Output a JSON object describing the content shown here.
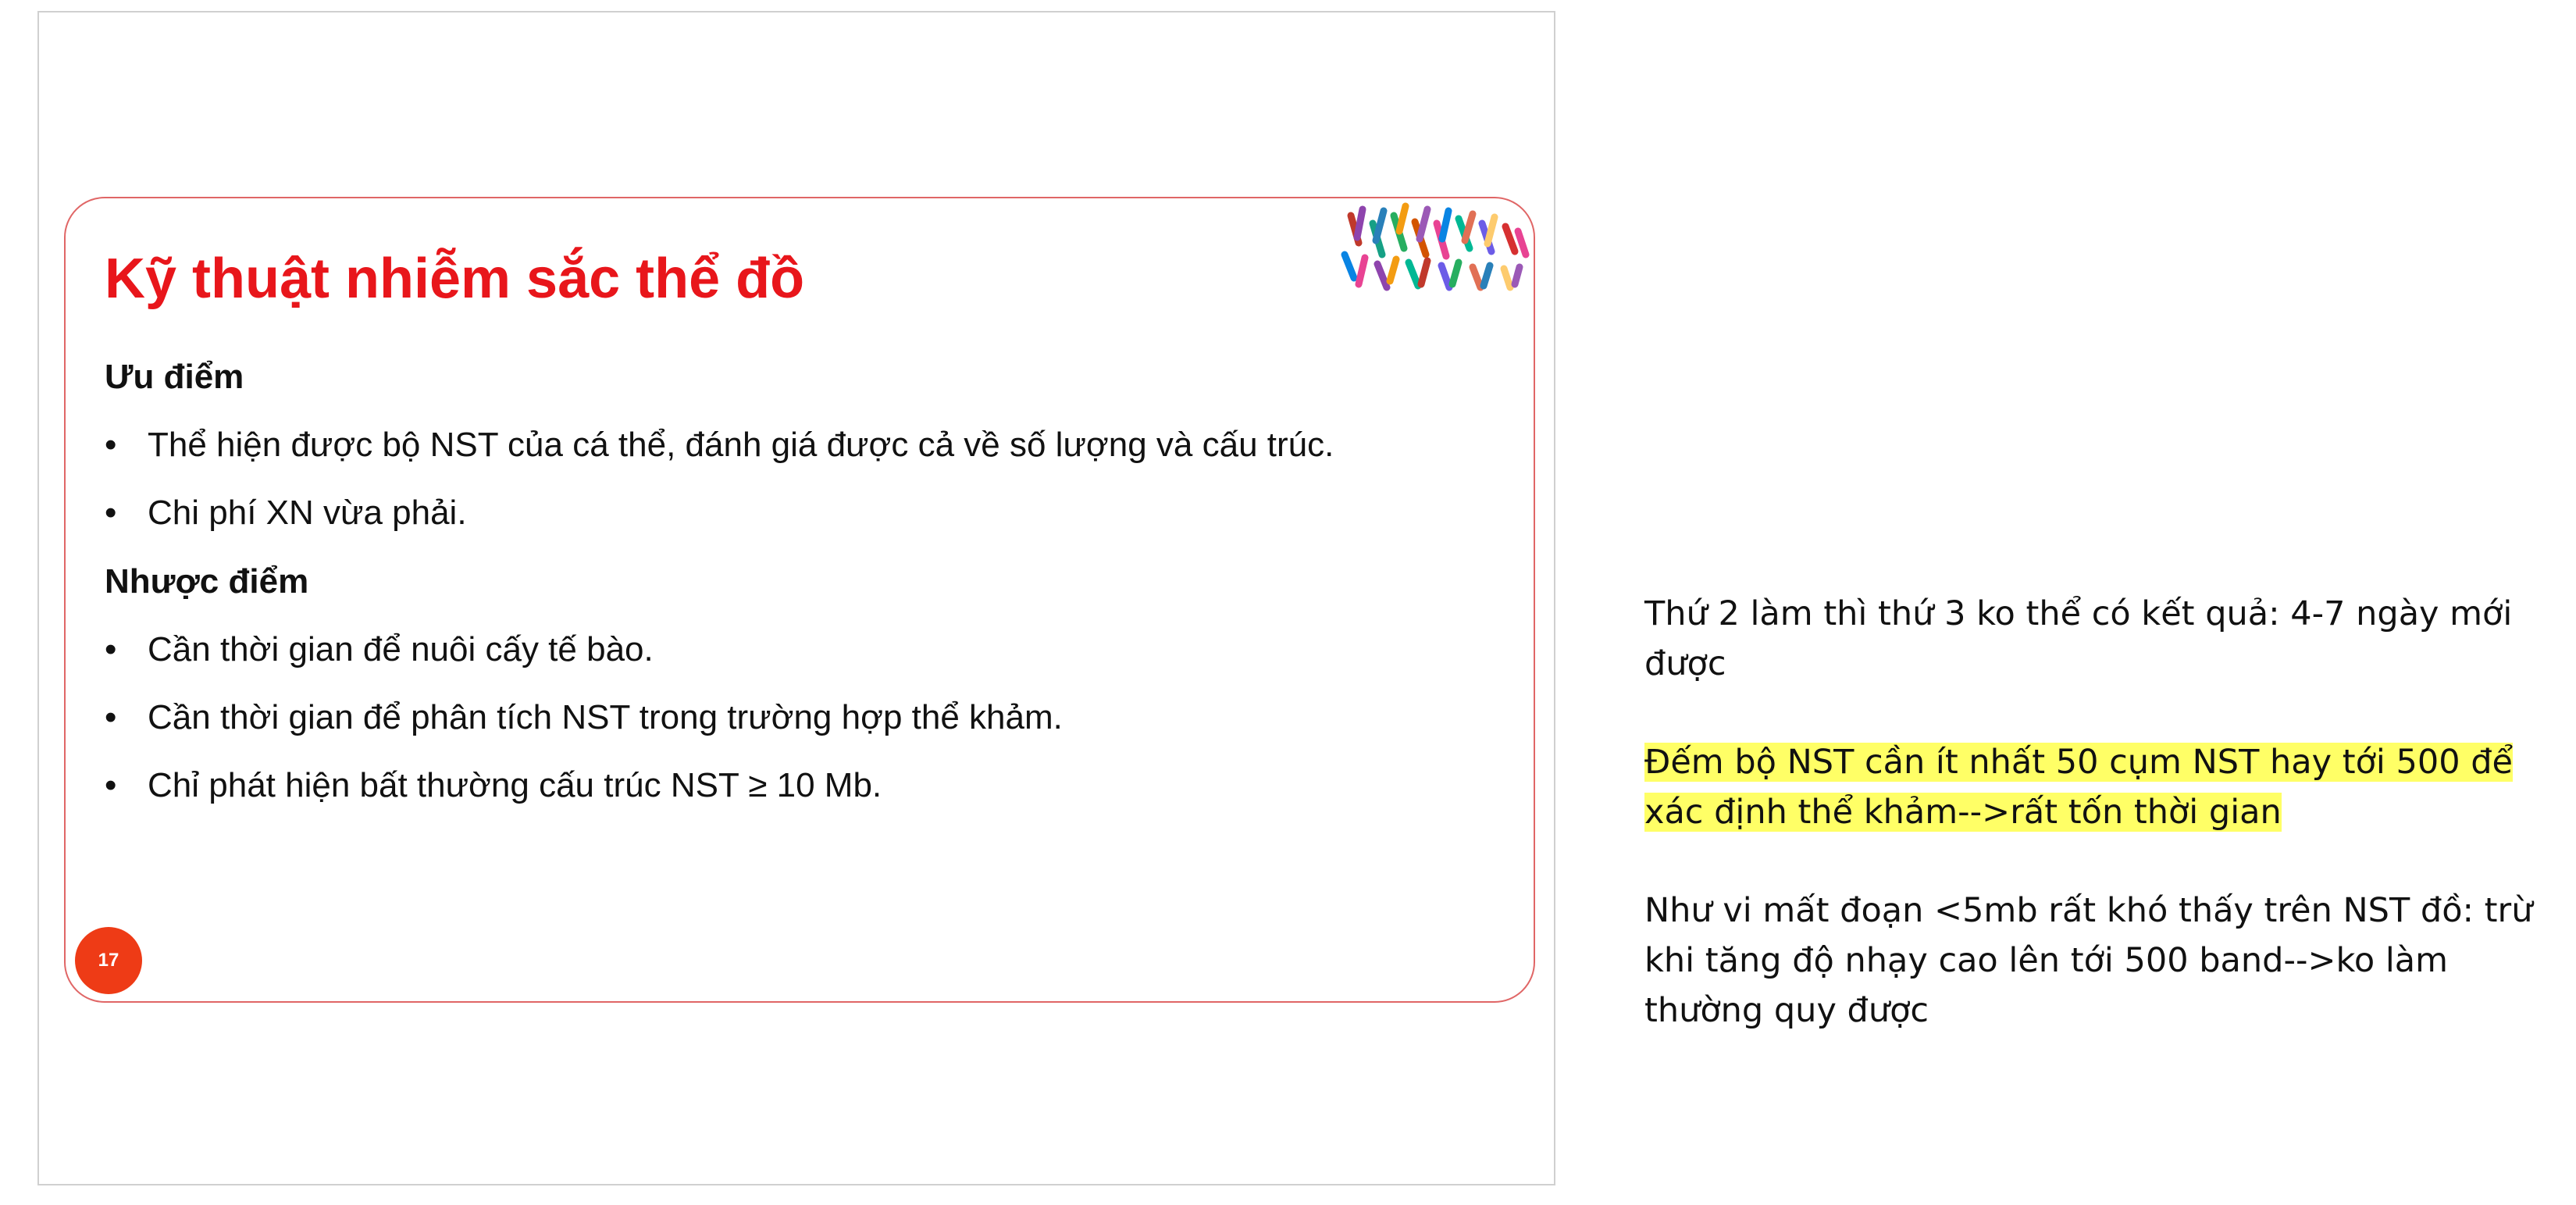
{
  "slide": {
    "title": "Kỹ thuật nhiễm sắc thể đồ",
    "page_number": "17",
    "pros_heading": "Ưu điểm",
    "pros": [
      "Thể hiện được bộ NST của cá thể, đánh giá được cả về số lượng và cấu trúc.",
      "Chi phí XN vừa phải."
    ],
    "cons_heading": "Nhược điểm",
    "cons": [
      "Cần thời gian để nuôi cấy tế bào.",
      "Cần thời gian để phân tích NST trong trường hợp thể khảm.",
      "Chỉ phát hiện bất thường cấu trúc NST ≥ 10 Mb."
    ],
    "bullet_glyph": "•",
    "decoration_icon": "chromosome-icon",
    "title_color": "#e8161b",
    "border_color": "#e06666",
    "badge_color": "#ee3b16"
  },
  "notes": {
    "note_1": [
      "Thứ 2 làm thì thứ 3 ko thể có kết quả: 4-7 ngày mới",
      "được"
    ],
    "note_2": [
      "Đếm bộ NST cần ít nhất 50 cụm NST hay tới 500 để",
      "xác định thể khảm-->rất tốn thời gian"
    ],
    "note_3": [
      "Như vi mất đoạn <5mb rất khó thấy trên NST đồ: trừ",
      "khi tăng độ nhạy cao lên tới 500 band-->ko làm",
      "thường quy được"
    ],
    "highlight_color": "#ffff66"
  }
}
